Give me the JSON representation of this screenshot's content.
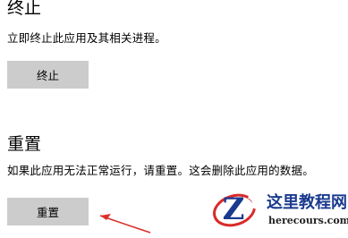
{
  "terminate": {
    "title": "终止",
    "description": "立即终止此应用及其相关进程。",
    "button_label": "终止"
  },
  "reset": {
    "title": "重置",
    "description": "如果此应用无法正常运行，请重置。这会删除此应用的数据。",
    "button_label": "重置"
  },
  "watermark": {
    "logo_letter": "Z",
    "site_name": "这里教程网",
    "site_url": "herecours.com"
  },
  "colors": {
    "button_bg": "#cccccc",
    "arrow": "#d9302b",
    "logo_ring": "#d92a2a",
    "logo_letter": "#1a3a8f",
    "site_name": "#1a3a8f"
  },
  "icons": {
    "arrow": "red-arrow-icon",
    "logo": "site-logo-icon"
  }
}
